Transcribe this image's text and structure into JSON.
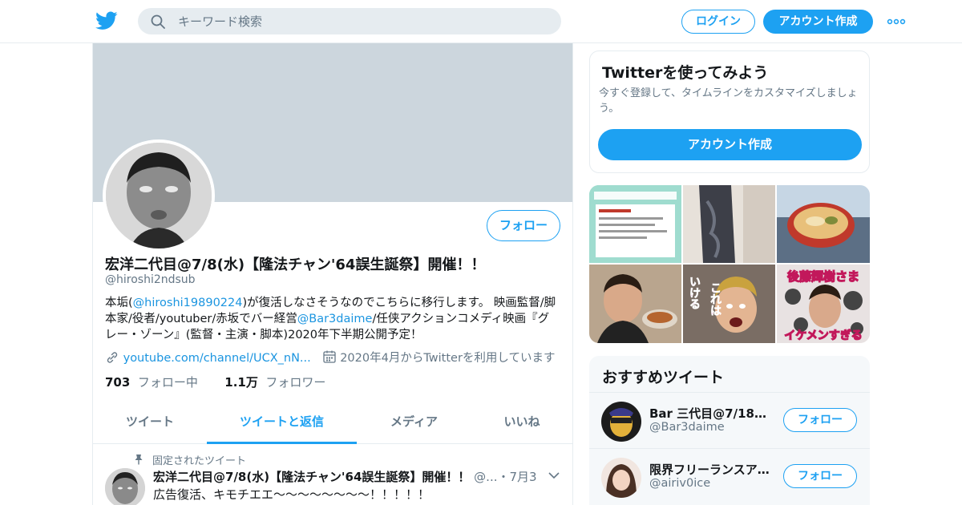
{
  "header": {
    "search_placeholder": "キーワード検索",
    "login_label": "ログイン",
    "signup_label": "アカウント作成"
  },
  "profile": {
    "follow_label": "フォロー",
    "name": "宏洋二代目@7/8(水)【隆法チャン'64誤生誕祭】開催！！",
    "handle": "@hiroshi2ndsub",
    "bio_part1": "本垢(",
    "bio_link1": "@hiroshi19890224",
    "bio_part2": ")が復活しなさそうなのでこちらに移行します。 映画監督/脚本家/役者/youtuber/赤坂でバー経営",
    "bio_link2": "@Bar3daime",
    "bio_part3": "/任侠アクションコメディ映画『グレー・ゾーン』(監督・主演・脚本)2020年下半期公開予定！",
    "url": "youtube.com/channel/UCX_nN...",
    "joined": "2020年4月からTwitterを利用しています",
    "following_count": "703",
    "following_label": "フォロー中",
    "followers_count": "1.1万",
    "followers_label": "フォロワー"
  },
  "tabs": [
    {
      "label": "ツイート"
    },
    {
      "label": "ツイートと返信"
    },
    {
      "label": "メディア"
    },
    {
      "label": "いいね"
    }
  ],
  "pinned_tweet": {
    "pinned_label": "固定されたツイート",
    "author": "宏洋二代目@7/8(水)【隆法チャン'64誤生誕祭】開催！！",
    "meta": "@...・7月3日",
    "text": "広告復活、キモチエエ〜〜〜〜〜〜〜〜！！！！！"
  },
  "signup_card": {
    "title": "Twitterを使ってみよう",
    "description": "今すぐ登録して、タイムラインをカスタマイズしましょう。",
    "cta": "アカウント作成"
  },
  "media_overlays": {
    "cell5_text": "これは",
    "cell5_text2": "いける",
    "cell6_top": "後藤輝樹さま",
    "cell6_bottom": "イケメンすぎる"
  },
  "recommended": {
    "title": "おすすめツイート",
    "items": [
      {
        "name": "Bar 三代目@7/18出…",
        "handle": "@Bar3daime",
        "follow": "フォロー"
      },
      {
        "name": "限界フリーランスア…",
        "handle": "@airiv0ice",
        "follow": "フォロー"
      }
    ]
  },
  "colors": {
    "accent": "#1da1f2",
    "banner": "#ccd6dd",
    "muted_text": "#657786"
  }
}
